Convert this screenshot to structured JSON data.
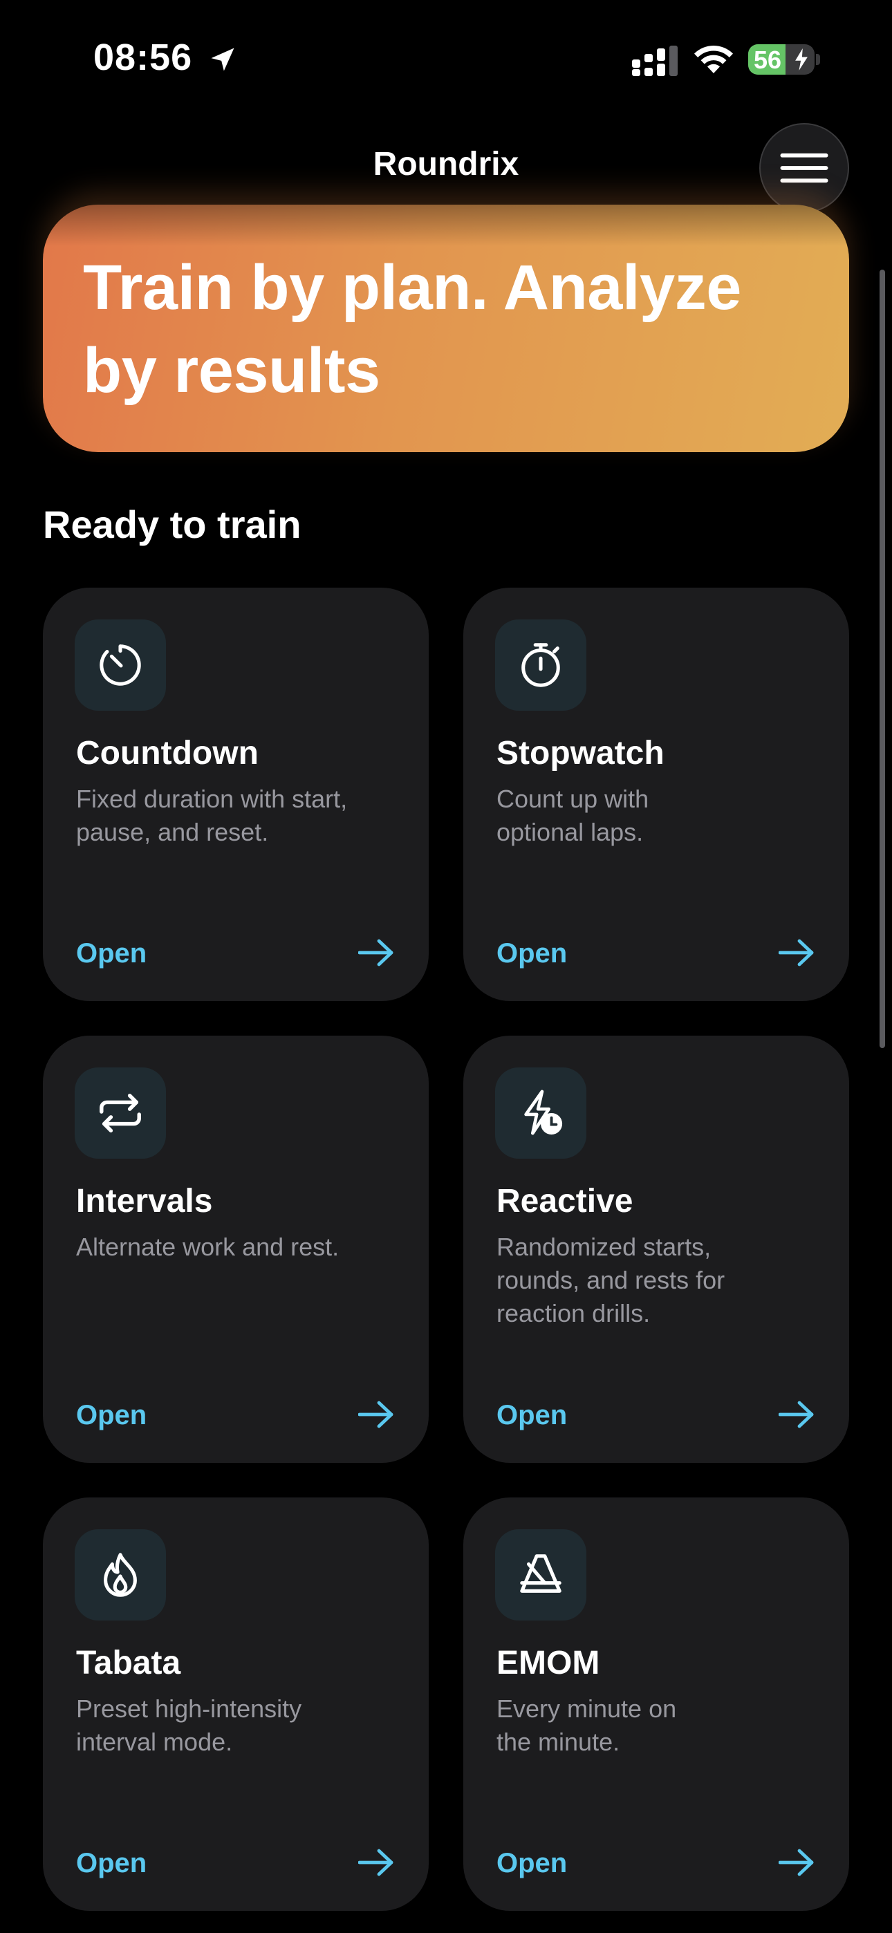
{
  "status_bar": {
    "time": "08:56",
    "battery_level": "56",
    "battery_fraction": 0.56,
    "location_icon": "location-arrow-icon",
    "signal_icon": "cellular-signal-icon",
    "wifi_icon": "wifi-icon",
    "charging_icon": "bolt-icon"
  },
  "nav": {
    "title": "Roundrix",
    "menu_icon": "hamburger-menu-icon"
  },
  "hero": {
    "headline": "Train by plan. Analyze by results",
    "gradient_start": "#e2784a",
    "gradient_end": "#e2ad55"
  },
  "section": {
    "title": "Ready to train"
  },
  "colors": {
    "accent": "#5ac8ef",
    "card_bg": "#1c1c1e",
    "icon_tile_bg": "#1f2b31",
    "secondary_text": "#98989f"
  },
  "cards": [
    {
      "title": "Countdown",
      "description": "Fixed duration with start, pause, and reset.",
      "action": "Open",
      "icon": "countdown-timer-icon"
    },
    {
      "title": "Stopwatch",
      "description": "Count up with optional laps.",
      "action": "Open",
      "icon": "stopwatch-icon"
    },
    {
      "title": "Intervals",
      "description": "Alternate work and rest.",
      "action": "Open",
      "icon": "repeat-arrows-icon"
    },
    {
      "title": "Reactive",
      "description": "Randomized starts, rounds, and rests for reaction drills.",
      "action": "Open",
      "icon": "bolt-clock-icon"
    },
    {
      "title": "Tabata",
      "description": "Preset high-intensity interval mode.",
      "action": "Open",
      "icon": "flame-icon"
    },
    {
      "title": "EMOM",
      "description": "Every minute on the minute.",
      "action": "Open",
      "icon": "metronome-icon"
    }
  ]
}
